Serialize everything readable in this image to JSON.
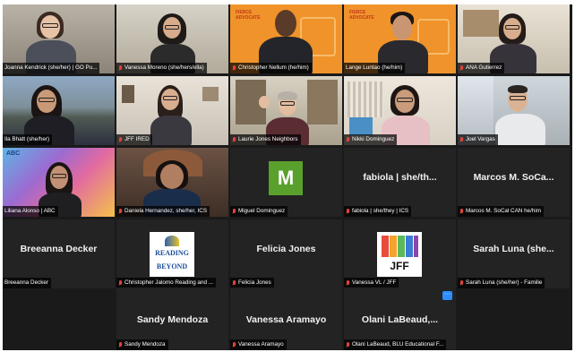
{
  "tiles": [
    {
      "name": "Joanna Kendrick (she/her) | GO Pu..."
    },
    {
      "name": "Vanessa Moreno (she/hers/ella)"
    },
    {
      "name": "Christopher Nellum (he/him)"
    },
    {
      "name": "Lange Luntao (he/him)"
    },
    {
      "name": "ANA Gutierrez"
    },
    {
      "name": "Ila Bhatt (she/her)"
    },
    {
      "name": "JFF IRED"
    },
    {
      "name": "Laurie Jones Neighbors"
    },
    {
      "name": "Nikki Dominguez"
    },
    {
      "name": "Joel Vargas"
    },
    {
      "name": "Liliana Alonso | ABC"
    },
    {
      "name": "Daniela Hernandez, she/her, ICS"
    },
    {
      "name": "Miguel Dominguez",
      "initial": "M"
    },
    {
      "name": "fabiola | she/they | ICS",
      "display": "fabiola | she/th..."
    },
    {
      "name": "Marcos M. SoCal CAN he/him",
      "display": "Marcos M. SoCa..."
    },
    {
      "name": "Breeanna Decker",
      "display": "Breeanna Decker"
    },
    {
      "name": "Christopher Jalomo Reading and ..."
    },
    {
      "name": "Felicia Jones",
      "display": "Felicia Jones"
    },
    {
      "name": "Vanessa VL / JFF"
    },
    {
      "name": "Sarah Luna (she/her) - Familie",
      "display": "Sarah Luna (she..."
    },
    {
      "name": "Sandy Mendoza",
      "display": "Sandy Mendoza"
    },
    {
      "name": "Vanessa Aramayo",
      "display": "Vanessa Aramayo"
    },
    {
      "name": "Olani LaBeaud, BLU Educational F...",
      "display": "Olani LaBeaud,..."
    }
  ],
  "labels": {
    "fierce_logo": "FIERCE ADVOCATE",
    "fierce_logo_2": "FIERCE ADVOCATE",
    "abc_logo": "ABC",
    "reading_line1": "READING",
    "reading_line2": "BEYOND",
    "jff_logo": "JFF",
    "menu": "···"
  },
  "colors": {
    "active_speaker": "#7ad14a",
    "orange_bg": "#f0932b",
    "green_avatar": "#5aa02c",
    "muted_mic": "#e0443c"
  }
}
